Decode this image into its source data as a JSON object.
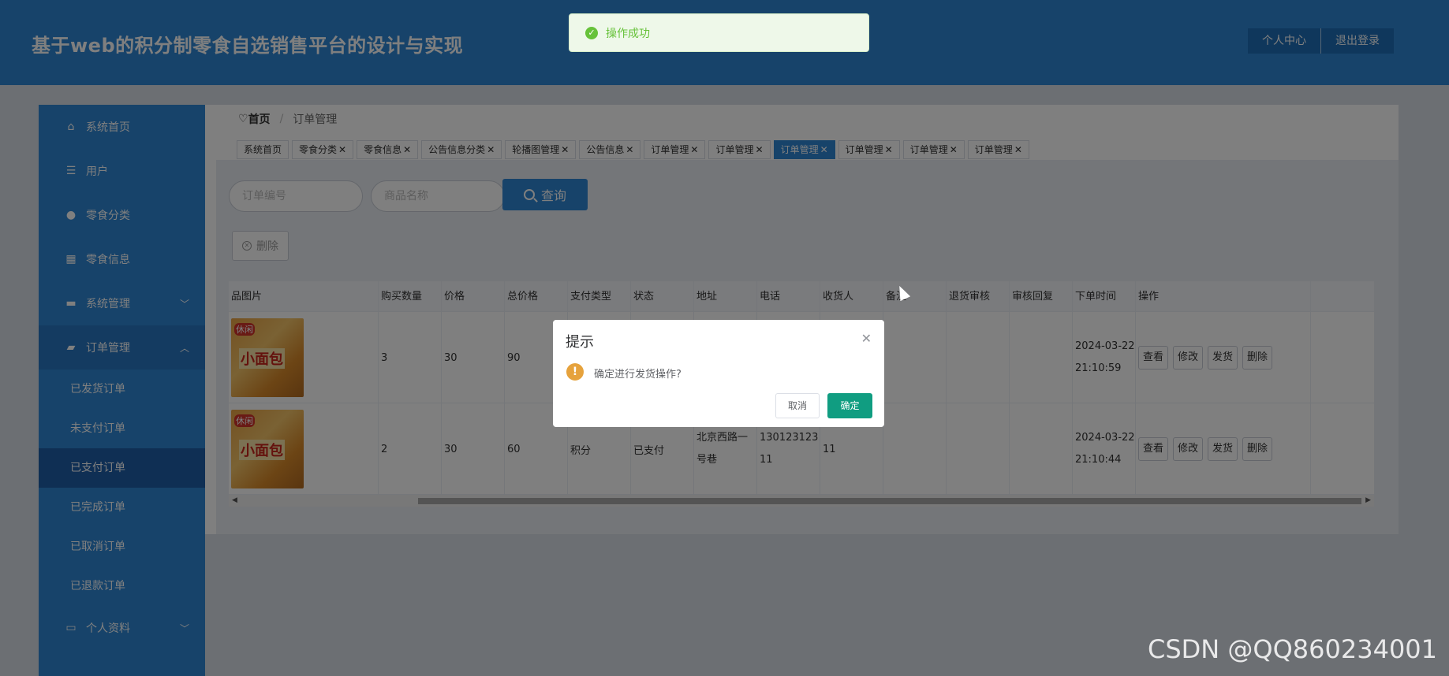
{
  "header": {
    "title": "基于web的积分制零食自选销售平台的设计与实现",
    "personal_center": "个人中心",
    "logout": "退出登录"
  },
  "toast": {
    "message": "操作成功",
    "icon": "check-circle-icon"
  },
  "sidebar": {
    "items": [
      {
        "label": "系统首页",
        "icon": "home-icon"
      },
      {
        "label": "用户",
        "icon": "list-icon"
      },
      {
        "label": "零食分类",
        "icon": "bulb-icon"
      },
      {
        "label": "零食信息",
        "icon": "grid-icon"
      },
      {
        "label": "系统管理",
        "icon": "chat-icon"
      },
      {
        "label": "订单管理",
        "icon": "briefcase-icon"
      }
    ],
    "order_submenu": [
      "已发货订单",
      "未支付订单",
      "已支付订单",
      "已完成订单",
      "已取消订单",
      "已退款订单"
    ],
    "profile": {
      "label": "个人资料",
      "icon": "card-icon"
    }
  },
  "breadcrumb": {
    "home": "首页",
    "current": "订单管理"
  },
  "tabs": [
    {
      "label": "系统首页",
      "closable": false
    },
    {
      "label": "零食分类",
      "closable": true
    },
    {
      "label": "零食信息",
      "closable": true
    },
    {
      "label": "公告信息分类",
      "closable": true
    },
    {
      "label": "轮播图管理",
      "closable": true
    },
    {
      "label": "公告信息",
      "closable": true
    },
    {
      "label": "订单管理",
      "closable": true
    },
    {
      "label": "订单管理",
      "closable": true
    },
    {
      "label": "订单管理",
      "closable": true,
      "active": true
    },
    {
      "label": "订单管理",
      "closable": true
    },
    {
      "label": "订单管理",
      "closable": true
    },
    {
      "label": "订单管理",
      "closable": true
    }
  ],
  "search": {
    "order_no_placeholder": "订单编号",
    "product_name_placeholder": "商品名称",
    "query_label": "查询"
  },
  "delete_label": "删除",
  "table": {
    "columns": [
      "品图片",
      "购买数量",
      "价格",
      "总价格",
      "支付类型",
      "状态",
      "地址",
      "电话",
      "收货人",
      "备注",
      "退货审核",
      "审核回复",
      "下单时间",
      "操作"
    ],
    "rows": [
      {
        "image_text": "小面包",
        "image_brand": "休闲",
        "qty": "3",
        "price": "30",
        "total": "90",
        "pay_type": "",
        "status": "",
        "address": "",
        "phone": "",
        "receiver": "",
        "remark": "",
        "return_review": "",
        "review_reply": "",
        "time_date": "2024-03-22",
        "time_clock": "21:10:59"
      },
      {
        "image_text": "小面包",
        "image_brand": "休闲",
        "qty": "2",
        "price": "30",
        "total": "60",
        "pay_type": "积分",
        "status": "已支付",
        "address": "北京西路一号巷",
        "phone": "13012312311",
        "receiver": "11",
        "remark": "",
        "return_review": "",
        "review_reply": "",
        "time_date": "2024-03-22",
        "time_clock": "21:10:44"
      }
    ],
    "ops": [
      "查看",
      "修改",
      "发货",
      "删除"
    ]
  },
  "dialog": {
    "title": "提示",
    "message": "确定进行发货操作?",
    "cancel": "取消",
    "confirm": "确定"
  },
  "watermark": "CSDN @QQ860234001"
}
